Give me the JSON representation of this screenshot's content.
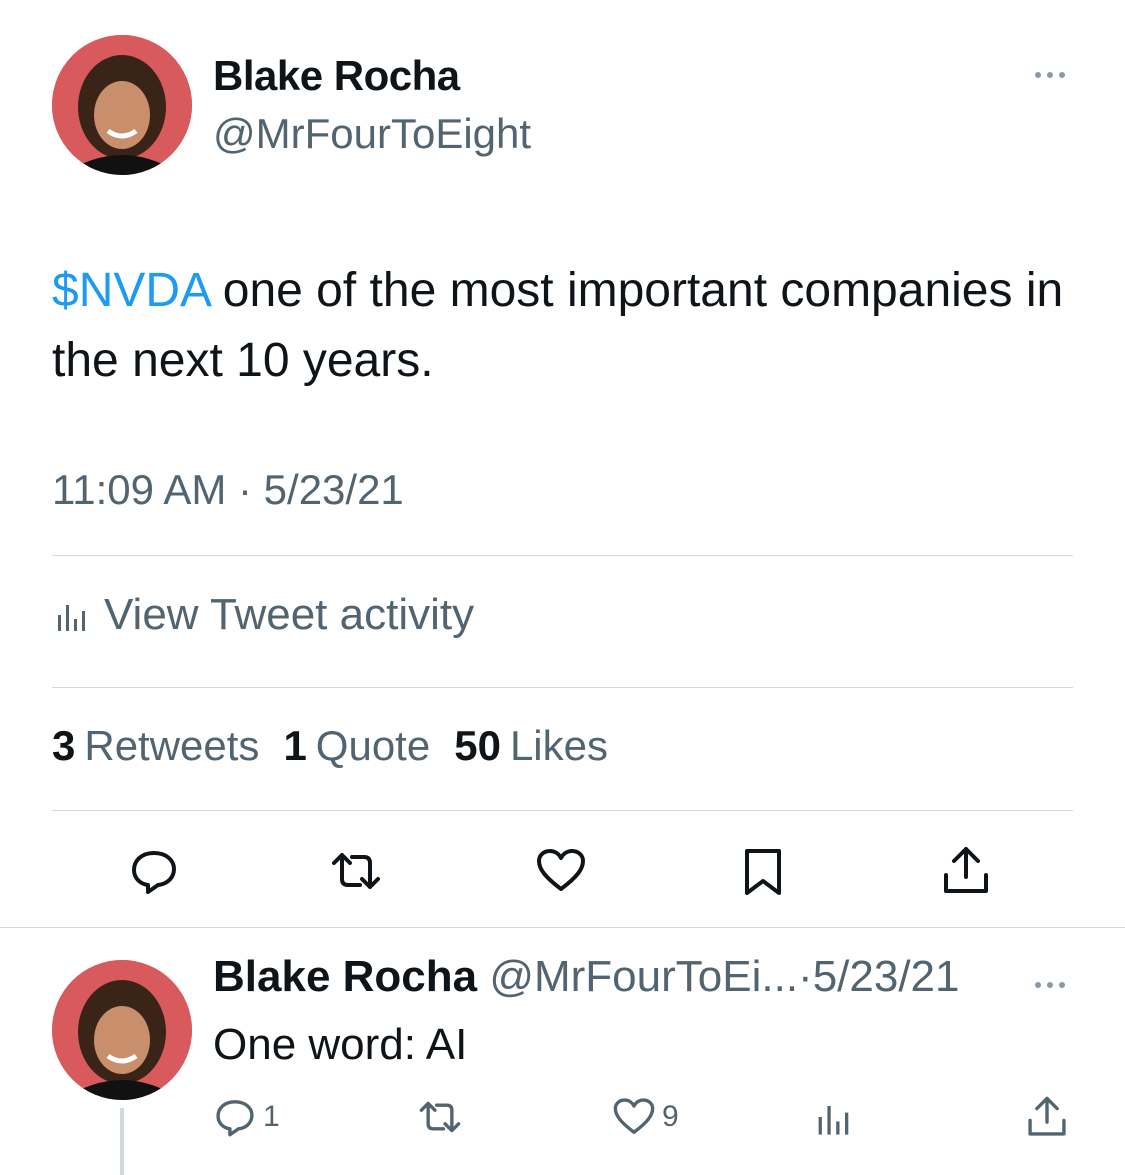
{
  "tweet": {
    "author_name": "Blake Rocha",
    "author_handle": "@MrFourToEight",
    "cashtag": "$NVDA",
    "text": " one of the most important companies in the next 10 years.",
    "timestamp": "11:09 AM · 5/23/21",
    "activity_label": "View Tweet activity",
    "stats": {
      "retweets_count": "3",
      "retweets_label": "Retweets",
      "quotes_count": "1",
      "quotes_label": "Quote",
      "likes_count": "50",
      "likes_label": "Likes"
    }
  },
  "reply": {
    "author_name": "Blake Rocha",
    "meta": " @MrFourToEi...·5/23/21",
    "text": "One word: AI",
    "reply_count": "1",
    "like_count": "9"
  },
  "colors": {
    "accent": "#1d9bf0",
    "secondary_text": "#536471",
    "divider": "#cfd9de",
    "avatar_bg": "#d85a5c"
  },
  "icons": [
    "more-icon",
    "analytics-icon",
    "reply-icon",
    "retweet-icon",
    "like-icon",
    "bookmark-icon",
    "share-icon"
  ]
}
